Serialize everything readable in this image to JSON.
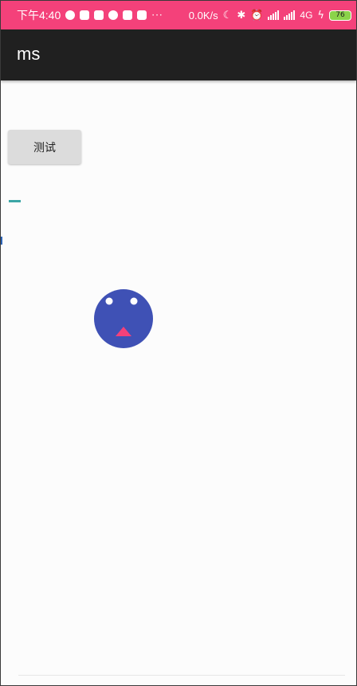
{
  "status_bar": {
    "time": "下午4:40",
    "dots": "···",
    "speed": "0.0K/s",
    "network": "4G",
    "battery": "76",
    "background": "#f4417a"
  },
  "app_bar": {
    "title": "ms",
    "background": "#202020"
  },
  "content": {
    "test_button_label": "测试",
    "face_color": "#3f51b5",
    "tongue_color": "#f4417a"
  }
}
